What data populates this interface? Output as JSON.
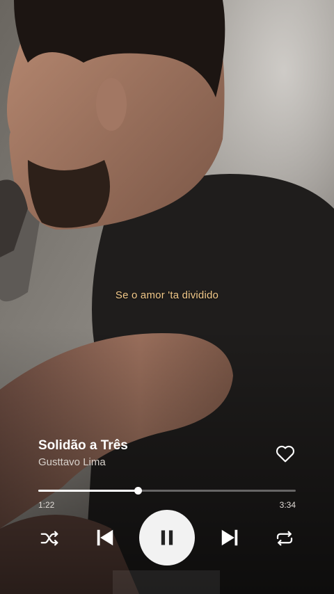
{
  "lyrics": {
    "current_line": "Se o amor 'ta dividido"
  },
  "track": {
    "title": "Solidão a Três",
    "artist": "Gusttavo Lima"
  },
  "playback": {
    "elapsed": "1:22",
    "total": "3:34",
    "progress_fraction": 0.386,
    "state": "playing"
  },
  "icons": {
    "like": "heart-outline-icon",
    "shuffle": "shuffle-icon",
    "previous": "skip-previous-icon",
    "play_pause": "pause-icon",
    "next": "skip-next-icon",
    "repeat": "repeat-icon"
  },
  "colors": {
    "lyric": "#f2c98a",
    "controls": "#ffffff",
    "play_button_bg": "#f2f2f2"
  }
}
